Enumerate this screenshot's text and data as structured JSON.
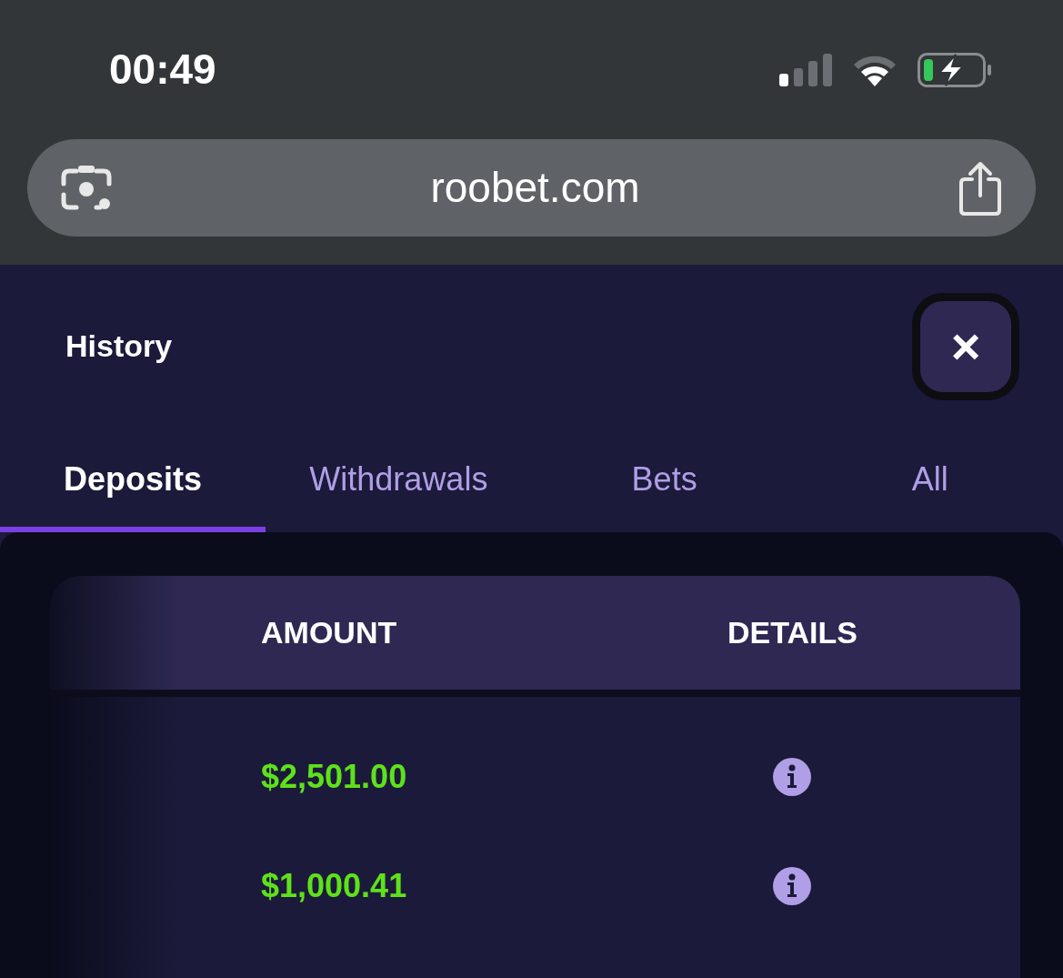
{
  "status_bar": {
    "time": "00:49"
  },
  "address_bar": {
    "url": "roobet.com"
  },
  "panel": {
    "title": "History",
    "close": "×"
  },
  "tabs": [
    {
      "label": "Deposits",
      "selected": true
    },
    {
      "label": "Withdrawals",
      "selected": false
    },
    {
      "label": "Bets",
      "selected": false
    },
    {
      "label": "All",
      "selected": false
    }
  ],
  "table": {
    "columns": [
      "AMOUNT",
      "DETAILS"
    ],
    "rows": [
      {
        "amount": "$2,501.00"
      },
      {
        "amount": "$1,000.41"
      }
    ]
  }
}
